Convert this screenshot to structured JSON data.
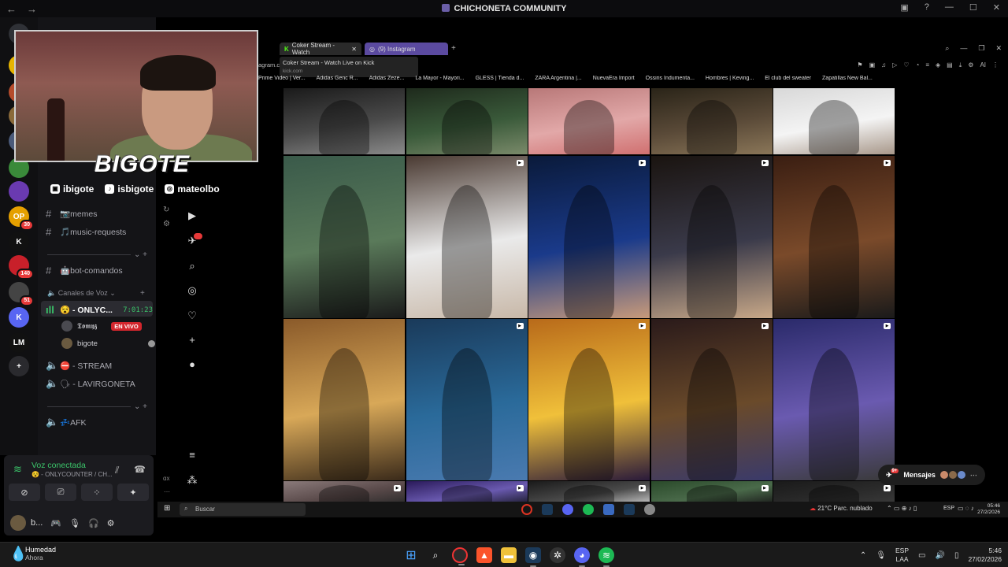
{
  "window": {
    "title": "CHICHONETA COMMUNITY"
  },
  "webcam": {
    "brand": "BIGOTE",
    "socials": [
      {
        "icon": "twitch-icon",
        "handle": "ibigote"
      },
      {
        "icon": "tiktok-icon",
        "handle": "isbigote"
      },
      {
        "icon": "instagram-icon",
        "handle": "mateolbo"
      }
    ]
  },
  "servers": [
    {
      "label": "",
      "color": "#2f3136",
      "badge": ""
    },
    {
      "label": "",
      "color": "#e6b400",
      "badge": ""
    },
    {
      "label": "",
      "color": "#b54c2c",
      "badge": ""
    },
    {
      "label": "",
      "color": "#8a6a3a",
      "badge": "10"
    },
    {
      "label": "",
      "color": "#4a5a7a",
      "badge": ""
    },
    {
      "label": "",
      "color": "#3a8a3a",
      "badge": ""
    },
    {
      "label": "",
      "color": "#6a3ab0",
      "badge": ""
    },
    {
      "label": "OP",
      "color": "#e5a000",
      "badge": "30"
    },
    {
      "label": "K",
      "color": "#111111",
      "badge": ""
    },
    {
      "label": "",
      "color": "#c8202a",
      "badge": "140"
    },
    {
      "label": "",
      "color": "#444444",
      "badge": "51"
    },
    {
      "label": "K",
      "color": "#5865f2",
      "badge": ""
    },
    {
      "label": "LM",
      "color": "#111111",
      "badge": ""
    },
    {
      "label": "+",
      "color": "#2a2a2e",
      "badge": ""
    }
  ],
  "channels": {
    "text": [
      {
        "name": "📷memes"
      },
      {
        "name": "🎵music-requests"
      },
      {
        "name": "🤖bot-comandos"
      }
    ],
    "voice_category": "Canales de Voz",
    "active_voice": {
      "name": "😵 - ONLYC...",
      "timer": "7:01:23"
    },
    "voice_users": [
      {
        "name": "𝕿𝖔𝖒𝖞𝖟",
        "live": "EN VIVO"
      },
      {
        "name": "bigote",
        "live": ""
      }
    ],
    "voice": [
      {
        "name": "⛔ - STREAM"
      },
      {
        "name": "🗣 - LAVIRGONETA"
      },
      {
        "name": "💤AFK"
      }
    ]
  },
  "voice_panel": {
    "status": "Voz conectada",
    "channel": "😵 - ONLYCOUNTER / CH...",
    "user_initial": "b..."
  },
  "browser": {
    "tabs": [
      {
        "label": "Coker Stream - Watch",
        "active": true
      },
      {
        "label": "(9) Instagram",
        "active": false
      }
    ],
    "tooltip": {
      "title": "Coker Stream - Watch Live on Kick",
      "url": "kick.com"
    },
    "address": "agram.c",
    "bookmarks": [
      "Prime Video | Ver...",
      "Adidas Genc R...",
      "Adidas Zeze...",
      "La Mayor - Mayori...",
      "GLESS | Tienda d...",
      "ZARA Argentina |...",
      "NuevaEra Import",
      "Ossiris Indumenta...",
      "Hombres | Keving...",
      "El club del sweater",
      "Zapatillas New Bal..."
    ]
  },
  "instagram": {
    "messages_label": "Mensajes",
    "messages_badge": "9+"
  },
  "inner_taskbar": {
    "search_placeholder": "Buscar",
    "weather": "21°C  Parc. nublado",
    "lang": "ESP",
    "time": "05:46",
    "date": "27/2/2026"
  },
  "taskbar": {
    "weather_title": "Humedad",
    "weather_sub": "Ahora",
    "lang_top": "ESP",
    "lang_bottom": "LAA",
    "time": "5:46",
    "date": "27/02/2026"
  }
}
